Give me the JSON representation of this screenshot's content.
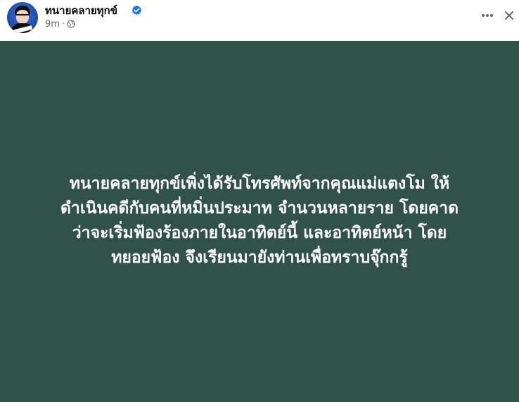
{
  "header": {
    "page_name": "ทนายคลายทุกข์",
    "time": "9m",
    "separator": "·",
    "privacy_icon": "globe-icon",
    "verified_icon": "verified-badge-icon",
    "more_icon": "more-horizontal-icon",
    "close_icon": "close-icon",
    "colors": {
      "name": "#050505",
      "meta": "#65676b",
      "verified": "#1877f2"
    }
  },
  "post": {
    "background_color": "#31524a",
    "text_color": "#ffffff",
    "lines": [
      "ทนายคลายทุกข์เพิ่งได้รับโทรศัพท์จากคุณแม่แตงโม ให้",
      "ดำเนินคดีกับคนที่หมิ่นประมาท จำนวนหลายราย โดยคาด",
      "ว่าจะเริ่มฟ้องร้องภายในอาทิตย์นี้ และอาทิตย์หน้า โดย",
      "ทยอยฟ้อง จึงเรียนมายังท่านเพื่อทราบจุ๊กกรู้"
    ]
  }
}
